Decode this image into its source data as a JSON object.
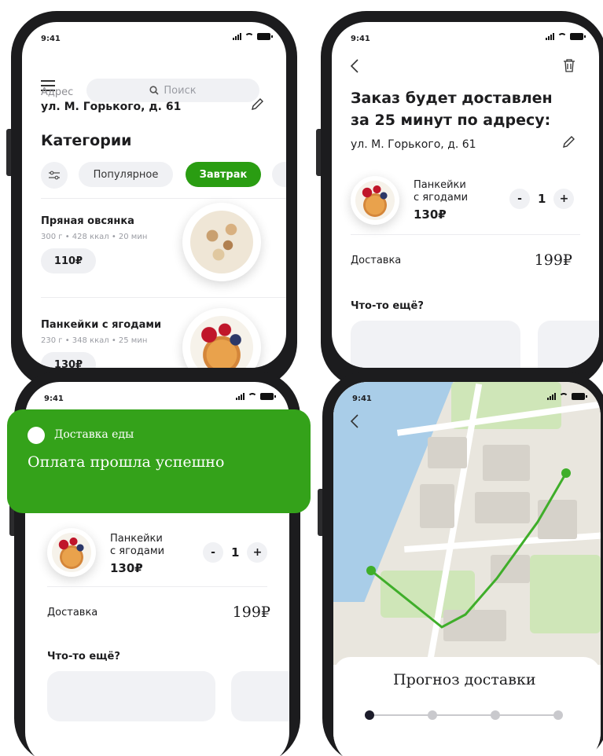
{
  "status": {
    "time": "9:41"
  },
  "menu_screen": {
    "search_placeholder": "Поиск",
    "address_label": "Адрес",
    "address": "ул. М. Горького, д. 61",
    "categories_title": "Категории",
    "chips": [
      "Популярное",
      "Завтрак"
    ],
    "items": [
      {
        "name": "Пряная овсянка",
        "meta": "300 г • 428 ккал • 20 мин",
        "price": "110₽"
      },
      {
        "name": "Панкейки с ягодами",
        "meta": "230 г • 348 ккал • 25 мин",
        "price": "130₽"
      }
    ]
  },
  "order_screen": {
    "title_line1": "Заказ будет доставлен",
    "title_line2": "за 25 минут по адресу:",
    "address": "ул. М. Горького, д. 61",
    "item_name_line1": "Панкейки",
    "item_name_line2": "с ягодами",
    "item_price": "130₽",
    "minus": "-",
    "qty": "1",
    "plus": "+",
    "delivery_label": "Доставка",
    "delivery_price": "199₽",
    "more_title": "Что-то ещё?"
  },
  "payment_screen": {
    "notification_app": "Доставка еды",
    "notification_text": "Оплата прошла успешно"
  },
  "map_screen": {
    "forecast_title": "Прогноз доставки",
    "progress": {
      "current_step": 1,
      "total_steps": 4
    }
  },
  "colors": {
    "accent_green": "#2a9d12",
    "notification_green": "#34a21a",
    "route_green": "#3fae2a"
  }
}
